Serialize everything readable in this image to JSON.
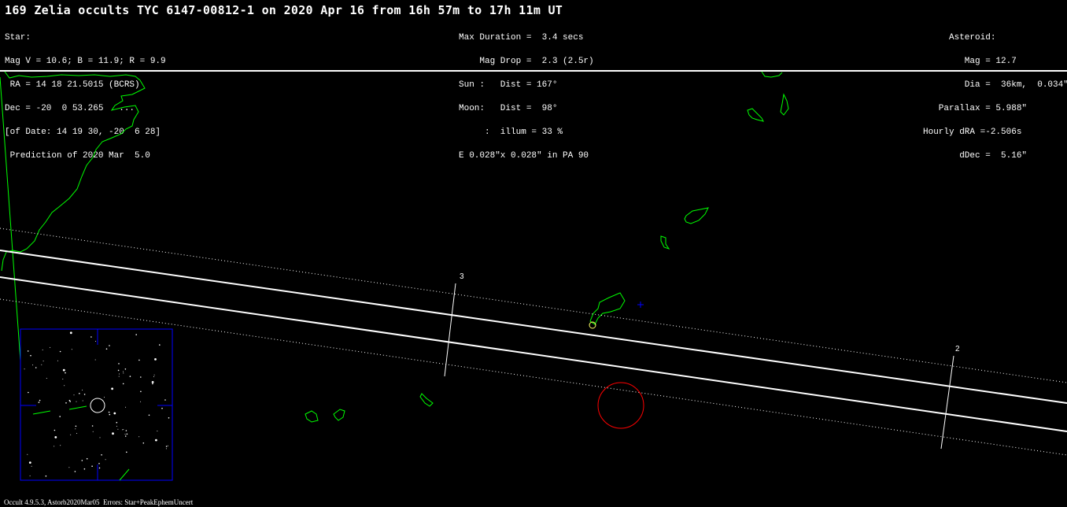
{
  "title": "169 Zelia occults TYC 6147-00812-1 on 2020 Apr 16 from 16h 57m to 17h 11m UT",
  "star_info": [
    "Star:",
    "Mag V = 10.6; B = 11.9; R = 9.9",
    " RA = 14 18 21.5015 (BCRS)",
    "Dec = -20  0 53.265   ...",
    "[of Date: 14 19 30, -20  6 28]",
    " Prediction of 2020 Mar  5.0"
  ],
  "event_info": [
    "Max Duration =  3.4 secs",
    "    Mag Drop =  2.3 (2.5r)",
    "Sun :   Dist = 167°",
    "Moon:   Dist =  98°",
    "     :  illum = 33 %",
    "E 0.028\"x 0.028\" in PA 90"
  ],
  "asteroid_info": [
    "     Asteroid:",
    "        Mag = 12.7",
    "        Dia =  36km,  0.034\"",
    "   Parallax = 5.988\"",
    "Hourly dRA =-2.506s",
    "       dDec =  5.16\""
  ],
  "footer": "Occult 4.9.5.3, Astorb2020Mar05  Errors: Star+PeakEphemUncert",
  "time_markers": [
    "3",
    "2"
  ],
  "colors": {
    "background": "#000000",
    "text": "#ffffff",
    "coastline": "#00ff00",
    "path_lines": "#ffffff",
    "finder_frame": "#0000ff",
    "sub_star_point": "#ff0000",
    "cross_marker": "#0000ff"
  }
}
